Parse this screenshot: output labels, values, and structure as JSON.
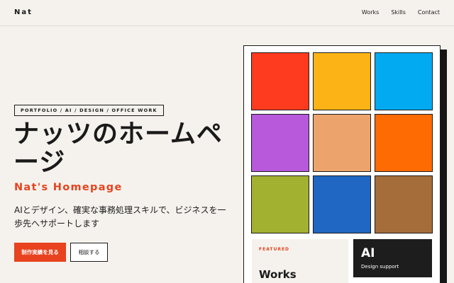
{
  "header": {
    "logo": "Nat",
    "nav": [
      {
        "label": "Works"
      },
      {
        "label": "Skills"
      },
      {
        "label": "Contact"
      }
    ]
  },
  "hero": {
    "badge": "PORTFOLIO / AI / DESIGN / OFFICE WORK",
    "title": "ナッツのホームページ",
    "subtitle": "Nat's Homepage",
    "description": "AIとデザイン、確実な事務処理スキルで、ビジネスを一歩先へサポートします",
    "primary_button": "制作実績を見る",
    "secondary_button": "相談する"
  },
  "colors": {
    "accent": "#e8421e",
    "background": "#f5f2ed",
    "tiles": [
      "#ff3b1f",
      "#fbb315",
      "#02aaf1",
      "#b859db",
      "#eca46c",
      "#fe6b02",
      "#a3b130",
      "#1f67c2",
      "#a46d39"
    ]
  },
  "featured": {
    "label": "FEATURED",
    "title": "Works"
  },
  "ai_card": {
    "title": "AI",
    "subtitle": "Design support"
  }
}
